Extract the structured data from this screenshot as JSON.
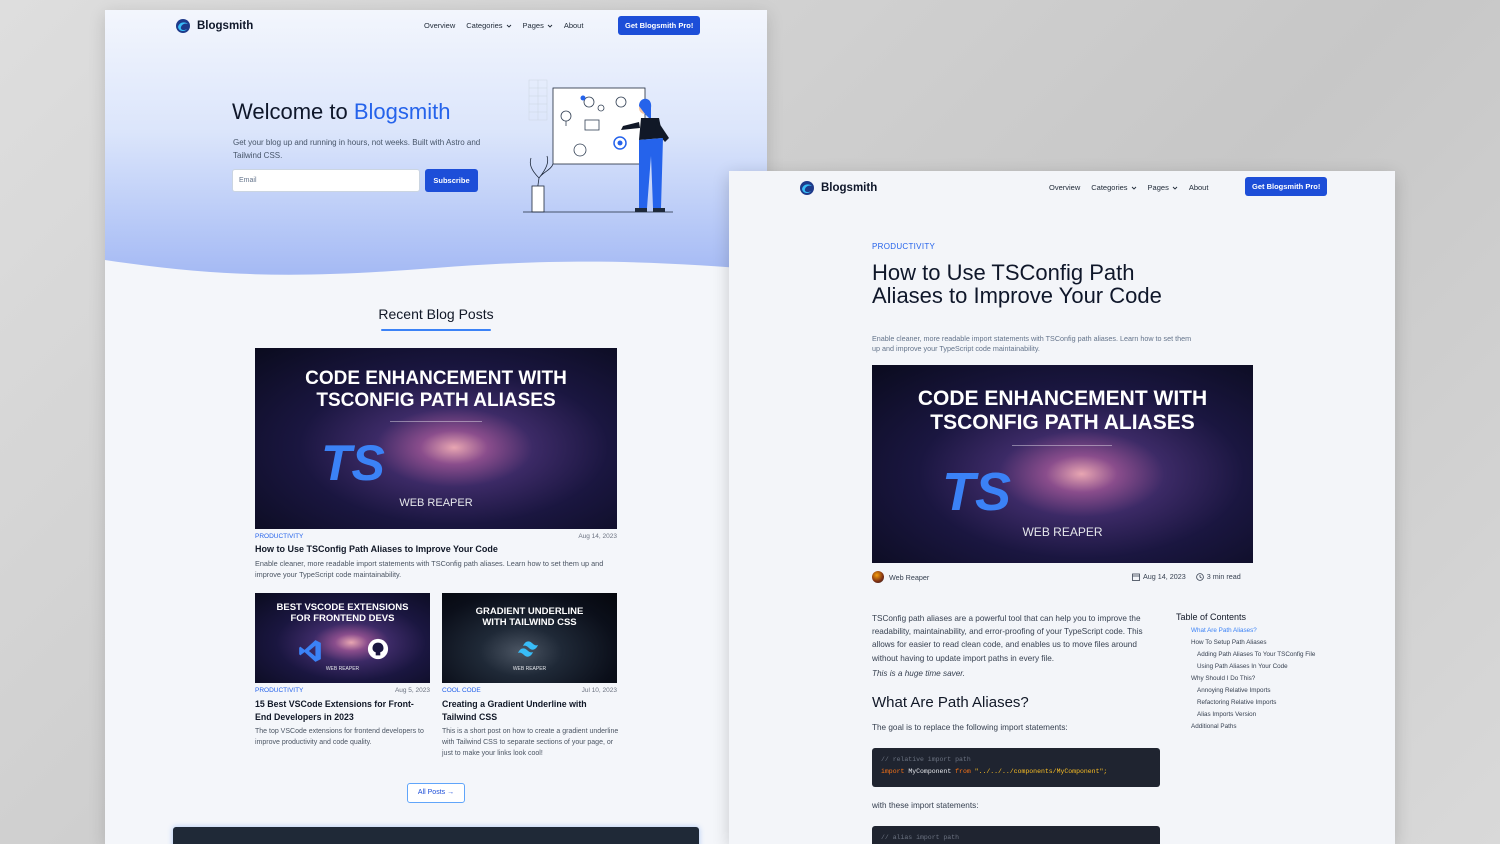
{
  "brand": {
    "name": "Blogsmith"
  },
  "nav": {
    "links": [
      "Overview",
      "Categories",
      "Pages",
      "About"
    ],
    "cta": "Get Blogsmith Pro!"
  },
  "hero": {
    "title_prefix": "Welcome to ",
    "title_accent": "Blogsmith",
    "subtitle": "Get your blog up and running in hours, not weeks. Built with Astro and Tailwind CSS.",
    "email_placeholder": "Email",
    "subscribe_label": "Subscribe"
  },
  "recent": {
    "title": "Recent Blog Posts",
    "all_posts_label": "All Posts →",
    "featured": {
      "thumb_title_1": "CODE ENHANCEMENT WITH",
      "thumb_title_2": "TSCONFIG PATH ALIASES",
      "thumb_ts": "TS",
      "thumb_brand": "WEB REAPER",
      "category": "PRODUCTIVITY",
      "date": "Aug 14, 2023",
      "title": "How to Use TSConfig Path Aliases to Improve Your Code",
      "excerpt": "Enable cleaner, more readable import statements with TSConfig path aliases. Learn how to set them up and improve your TypeScript code maintainability."
    },
    "posts": [
      {
        "thumb_title_1": "BEST VSCODE EXTENSIONS",
        "thumb_title_2": "FOR FRONTEND DEVS",
        "thumb_brand": "WEB REAPER",
        "category": "PRODUCTIVITY",
        "date": "Aug 5, 2023",
        "title": "15 Best VSCode Extensions for Front-End Developers in 2023",
        "excerpt": "The top VSCode extensions for frontend developers to improve productivity and code quality."
      },
      {
        "thumb_title_1": "GRADIENT UNDERLINE",
        "thumb_title_2": "WITH TAILWIND CSS",
        "thumb_brand": "WEB REAPER",
        "category": "COOL CODE",
        "date": "Jul 10, 2023",
        "title": "Creating a Gradient Underline with Tailwind CSS",
        "excerpt": "This is a short post on how to create a gradient underline with Tailwind CSS to separate sections of your page, or just to make your links look cool!"
      }
    ]
  },
  "post": {
    "category": "PRODUCTIVITY",
    "title": "How to Use TSConfig Path Aliases to Improve Your Code",
    "description": "Enable cleaner, more readable import statements with TSConfig path aliases. Learn how to set them up and improve your TypeScript code maintainability.",
    "author": "Web Reaper",
    "date": "Aug 14, 2023",
    "read_time": "3 min read",
    "intro": "TSConfig path aliases are a powerful tool that can help you to improve the readability, maintainability, and error-proofing of your TypeScript code. This allows for easier to read clean code, and enables us to move files around without having to update import paths in every file.",
    "intro_em": "This is a huge time saver.",
    "h2": "What Are Path Aliases?",
    "goal": "The goal is to replace the following import statements:",
    "code1": {
      "comment": "// relative import path",
      "kw_import": "import",
      "ident": "MyComponent",
      "kw_from": "from",
      "path": "\"../../../components/MyComponent\";"
    },
    "with_text": "with these import statements:",
    "code2": {
      "comment": "// alias import path"
    },
    "toc": {
      "title": "Table of Contents",
      "items": [
        {
          "label": "What Are Path Aliases?",
          "level": 1,
          "active": true
        },
        {
          "label": "How To Setup Path Aliases",
          "level": 1,
          "active": false
        },
        {
          "label": "Adding Path Aliases To Your TSConfig File",
          "level": 2,
          "active": false
        },
        {
          "label": "Using Path Aliases In Your Code",
          "level": 2,
          "active": false
        },
        {
          "label": "Why Should I Do This?",
          "level": 1,
          "active": false
        },
        {
          "label": "Annoying Relative Imports",
          "level": 2,
          "active": false
        },
        {
          "label": "Refactoring Relative Imports",
          "level": 2,
          "active": false
        },
        {
          "label": "Alias Imports Version",
          "level": 2,
          "active": false
        },
        {
          "label": "Additional Paths",
          "level": 1,
          "active": false
        }
      ]
    }
  },
  "colors": {
    "accent": "#2563eb",
    "cta": "#1d4ed8",
    "code_bg": "#1f2430"
  },
  "icons": [
    "logo-swirl-icon",
    "chevron-down-icon",
    "calendar-icon",
    "clock-icon",
    "github-icon",
    "vscode-icon",
    "tailwind-icon",
    "arrow-right-icon"
  ]
}
